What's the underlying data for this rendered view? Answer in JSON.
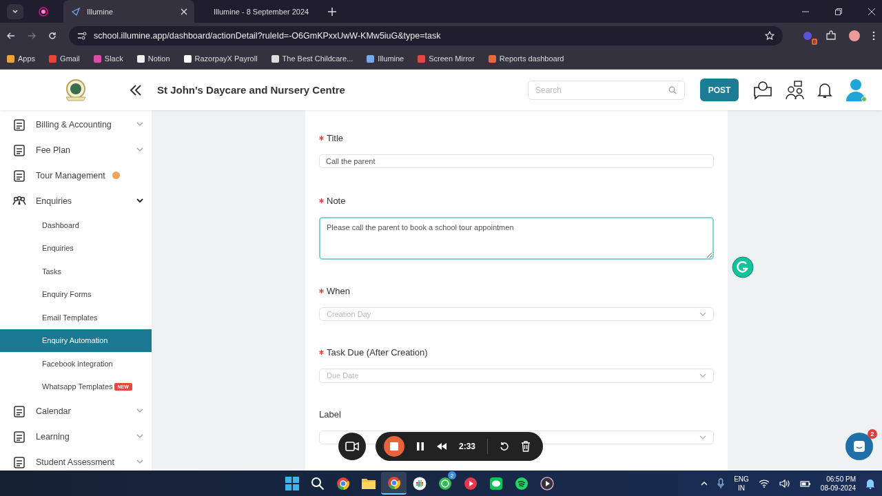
{
  "browser": {
    "tabs": [
      {
        "title": "Illumine",
        "selected": true
      },
      {
        "title": "Illumine - 8 September 2024",
        "selected": false
      }
    ],
    "url": "school.illumine.app/dashboard/actionDetail?ruleId=-O6GmKPxxUwW-KMw5iuG&type=task",
    "extension_badge": "8",
    "bookmarks": [
      "Apps",
      "Gmail",
      "Slack",
      "Notion",
      "RazorpayX Payroll",
      "The Best Childcare...",
      "Illumine",
      "Screen Mirror",
      "Reports dashboard"
    ]
  },
  "header": {
    "school_name": "St John's Daycare and Nursery Centre",
    "search": {
      "placeholder": "Search"
    },
    "post_button": "POST"
  },
  "sidebar": {
    "items": [
      {
        "label": "Billing & Accounting",
        "kind": "menu",
        "expanded": false
      },
      {
        "label": "Fee Plan",
        "kind": "menu",
        "expanded": false
      },
      {
        "label": "Tour Management",
        "kind": "link",
        "badge": true
      },
      {
        "label": "Enquiries",
        "kind": "menu",
        "expanded": true,
        "children": [
          {
            "label": "Dashboard",
            "selected": false
          },
          {
            "label": "Enquiries",
            "selected": false
          },
          {
            "label": "Tasks",
            "selected": false
          },
          {
            "label": "Enquiry Forms",
            "selected": false
          },
          {
            "label": "Email Templates",
            "selected": false
          },
          {
            "label": "Enquiry Automation",
            "selected": true
          },
          {
            "label": "Facebook integration",
            "selected": false
          },
          {
            "label": "Whatsapp Templates",
            "selected": false,
            "tag": "NEW"
          }
        ]
      },
      {
        "label": "Calendar",
        "kind": "menu",
        "expanded": false
      },
      {
        "label": "Learning",
        "kind": "menu",
        "expanded": false
      },
      {
        "label": "Student Assessment",
        "kind": "menu",
        "expanded": false
      }
    ]
  },
  "form": {
    "fields": [
      {
        "label": "Title",
        "required": true,
        "kind": "text",
        "value": "Call the parent"
      },
      {
        "label": "Note",
        "required": true,
        "kind": "textarea",
        "value": "Please call the parent to book a school tour appointmen",
        "focused": true
      },
      {
        "label": "When",
        "required": true,
        "kind": "select",
        "placeholder": "Creation Day"
      },
      {
        "label": "Task Due (After Creation)",
        "required": true,
        "kind": "select",
        "placeholder": "Due Date"
      },
      {
        "label": "Label",
        "required": false,
        "kind": "select"
      }
    ]
  },
  "recorder": {
    "time": "2:33"
  },
  "chat_badge": "2",
  "taskbar": {
    "apps": [
      {
        "kind": "start",
        "selected": false
      },
      {
        "kind": "search",
        "selected": false
      },
      {
        "kind": "chrome",
        "selected": false
      },
      {
        "kind": "folder",
        "selected": false
      },
      {
        "kind": "chrome",
        "selected": true
      },
      {
        "kind": "slack",
        "selected": false
      },
      {
        "kind": "whatsapp",
        "selected": false,
        "badge": "2"
      },
      {
        "kind": "video",
        "selected": false
      },
      {
        "kind": "line",
        "selected": false
      },
      {
        "kind": "spotify",
        "selected": false
      },
      {
        "kind": "player",
        "selected": false
      }
    ],
    "language": [
      "ENG",
      "IN"
    ],
    "time": "06:50 PM",
    "date": "08-09-2024"
  }
}
